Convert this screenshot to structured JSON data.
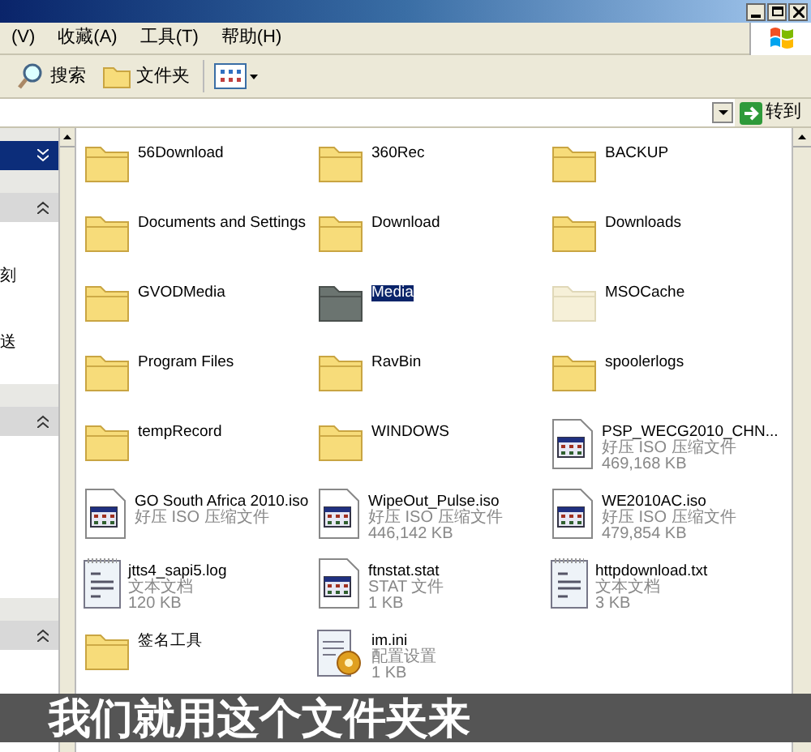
{
  "menu": [
    {
      "label": "(V)"
    },
    {
      "label": "收藏(A)"
    },
    {
      "label": "工具(T)"
    },
    {
      "label": "帮助(H)"
    }
  ],
  "toolbar": {
    "search": "搜索",
    "folders": "文件夹"
  },
  "address_bar": {
    "go": "转到"
  },
  "task_pane": {
    "sections": [
      {
        "kind": "dark"
      },
      {
        "kind": "light",
        "lines": [
          "刻",
          "送"
        ]
      },
      {
        "kind": "light"
      },
      {
        "kind": "light"
      }
    ]
  },
  "items": [
    {
      "name": "56Download",
      "kind": "folder",
      "selected": false,
      "hidden": false
    },
    {
      "name": "360Rec",
      "kind": "folder",
      "selected": false,
      "hidden": false
    },
    {
      "name": "BACKUP",
      "kind": "folder",
      "selected": false,
      "hidden": false
    },
    {
      "name": "Documents and Settings",
      "kind": "folder",
      "selected": false,
      "hidden": false
    },
    {
      "name": "Download",
      "kind": "folder",
      "selected": false,
      "hidden": false
    },
    {
      "name": "Downloads",
      "kind": "folder",
      "selected": false,
      "hidden": false
    },
    {
      "name": "GVODMedia",
      "kind": "folder",
      "selected": false,
      "hidden": false
    },
    {
      "name": "Media",
      "kind": "folder",
      "selected": true,
      "hidden": false
    },
    {
      "name": "MSOCache",
      "kind": "folder",
      "selected": false,
      "hidden": true
    },
    {
      "name": "Program Files",
      "kind": "folder",
      "selected": false,
      "hidden": false
    },
    {
      "name": "RavBin",
      "kind": "folder",
      "selected": false,
      "hidden": false
    },
    {
      "name": "spoolerlogs",
      "kind": "folder",
      "selected": false,
      "hidden": false
    },
    {
      "name": "tempRecord",
      "kind": "folder",
      "selected": false,
      "hidden": false
    },
    {
      "name": "WINDOWS",
      "kind": "folder",
      "selected": false,
      "hidden": false
    },
    {
      "name": "PSP_WECG2010_CHN...",
      "kind": "app",
      "type": "好压 ISO 压缩文件",
      "size": "469,168 KB",
      "selected": false
    },
    {
      "name": "GO South Africa 2010.iso",
      "kind": "app",
      "type": "好压 ISO 压缩文件",
      "selected": false
    },
    {
      "name": "WipeOut_Pulse.iso",
      "kind": "app",
      "type": "好压 ISO 压缩文件",
      "size": "446,142 KB",
      "selected": false
    },
    {
      "name": "WE2010AC.iso",
      "kind": "app",
      "type": "好压 ISO 压缩文件",
      "size": "479,854 KB",
      "selected": false
    },
    {
      "name": "jtts4_sapi5.log",
      "kind": "text",
      "type": "文本文档",
      "size": "120 KB",
      "selected": false
    },
    {
      "name": "ftnstat.stat",
      "kind": "app",
      "type": "STAT 文件",
      "size": "1 KB",
      "selected": false
    },
    {
      "name": "httpdownload.txt",
      "kind": "text",
      "type": "文本文档",
      "size": "3 KB",
      "selected": false
    },
    {
      "name": "签名工具",
      "kind": "folder",
      "selected": false,
      "hidden": false
    },
    {
      "name": "im.ini",
      "kind": "settings",
      "type": "配置设置",
      "size": "1 KB",
      "selected": false
    }
  ],
  "caption": "我们就用这个文件夹来"
}
